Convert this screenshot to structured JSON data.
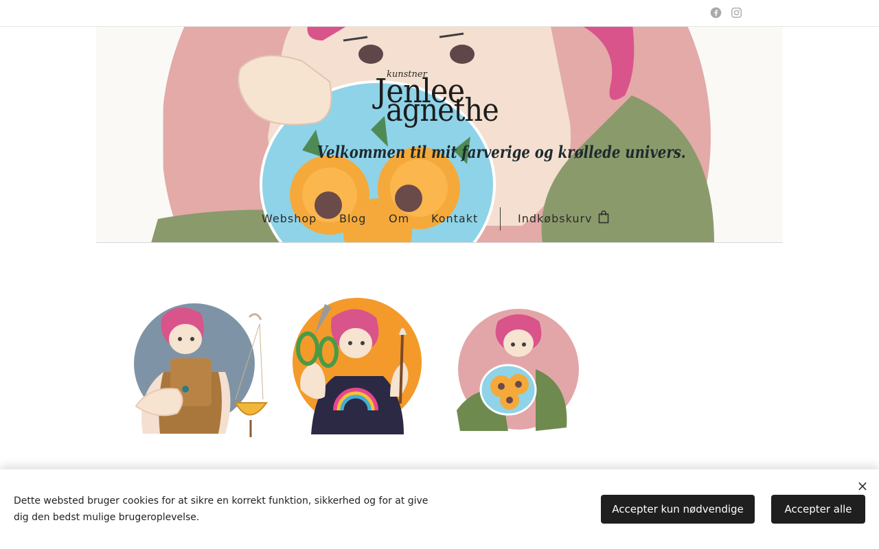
{
  "topbar": {
    "social": [
      {
        "icon": "facebook-icon"
      },
      {
        "icon": "instagram-icon"
      }
    ]
  },
  "header": {
    "logo_small": "kunstner",
    "logo_line1": "Jenlee",
    "logo_line2": "agnethe",
    "tagline": "Velkommen til mit farverige og krøllede univers."
  },
  "nav": {
    "items": [
      {
        "label": "Webshop"
      },
      {
        "label": "Blog"
      },
      {
        "label": "Om"
      },
      {
        "label": "Kontakt"
      }
    ],
    "cart_label": "Indkøbskurv",
    "cart_icon": "shopping-bag-icon"
  },
  "illustrations": [
    {
      "name": "illustration-plant-hanger",
      "bg": "#7e94a6"
    },
    {
      "name": "illustration-scissors-brush",
      "bg": "#f39a2b"
    },
    {
      "name": "illustration-sunflowers",
      "bg": "#e3a6a8"
    }
  ],
  "cookie": {
    "text": "Dette websted bruger cookies for at sikre en korrekt funktion, sikkerhed og for at give dig den bedst mulige brugeroplevelse.",
    "necessary_label": "Accepter kun nødvendige",
    "all_label": "Accepter alle",
    "close_symbol": "×"
  },
  "colors": {
    "pink_bg": "#e3aaa8",
    "hair": "#d9548b",
    "skin": "#f6e3d0",
    "green": "#8b9a6b",
    "sunflower": "#f5a93a",
    "button": "#1f1f1f"
  }
}
